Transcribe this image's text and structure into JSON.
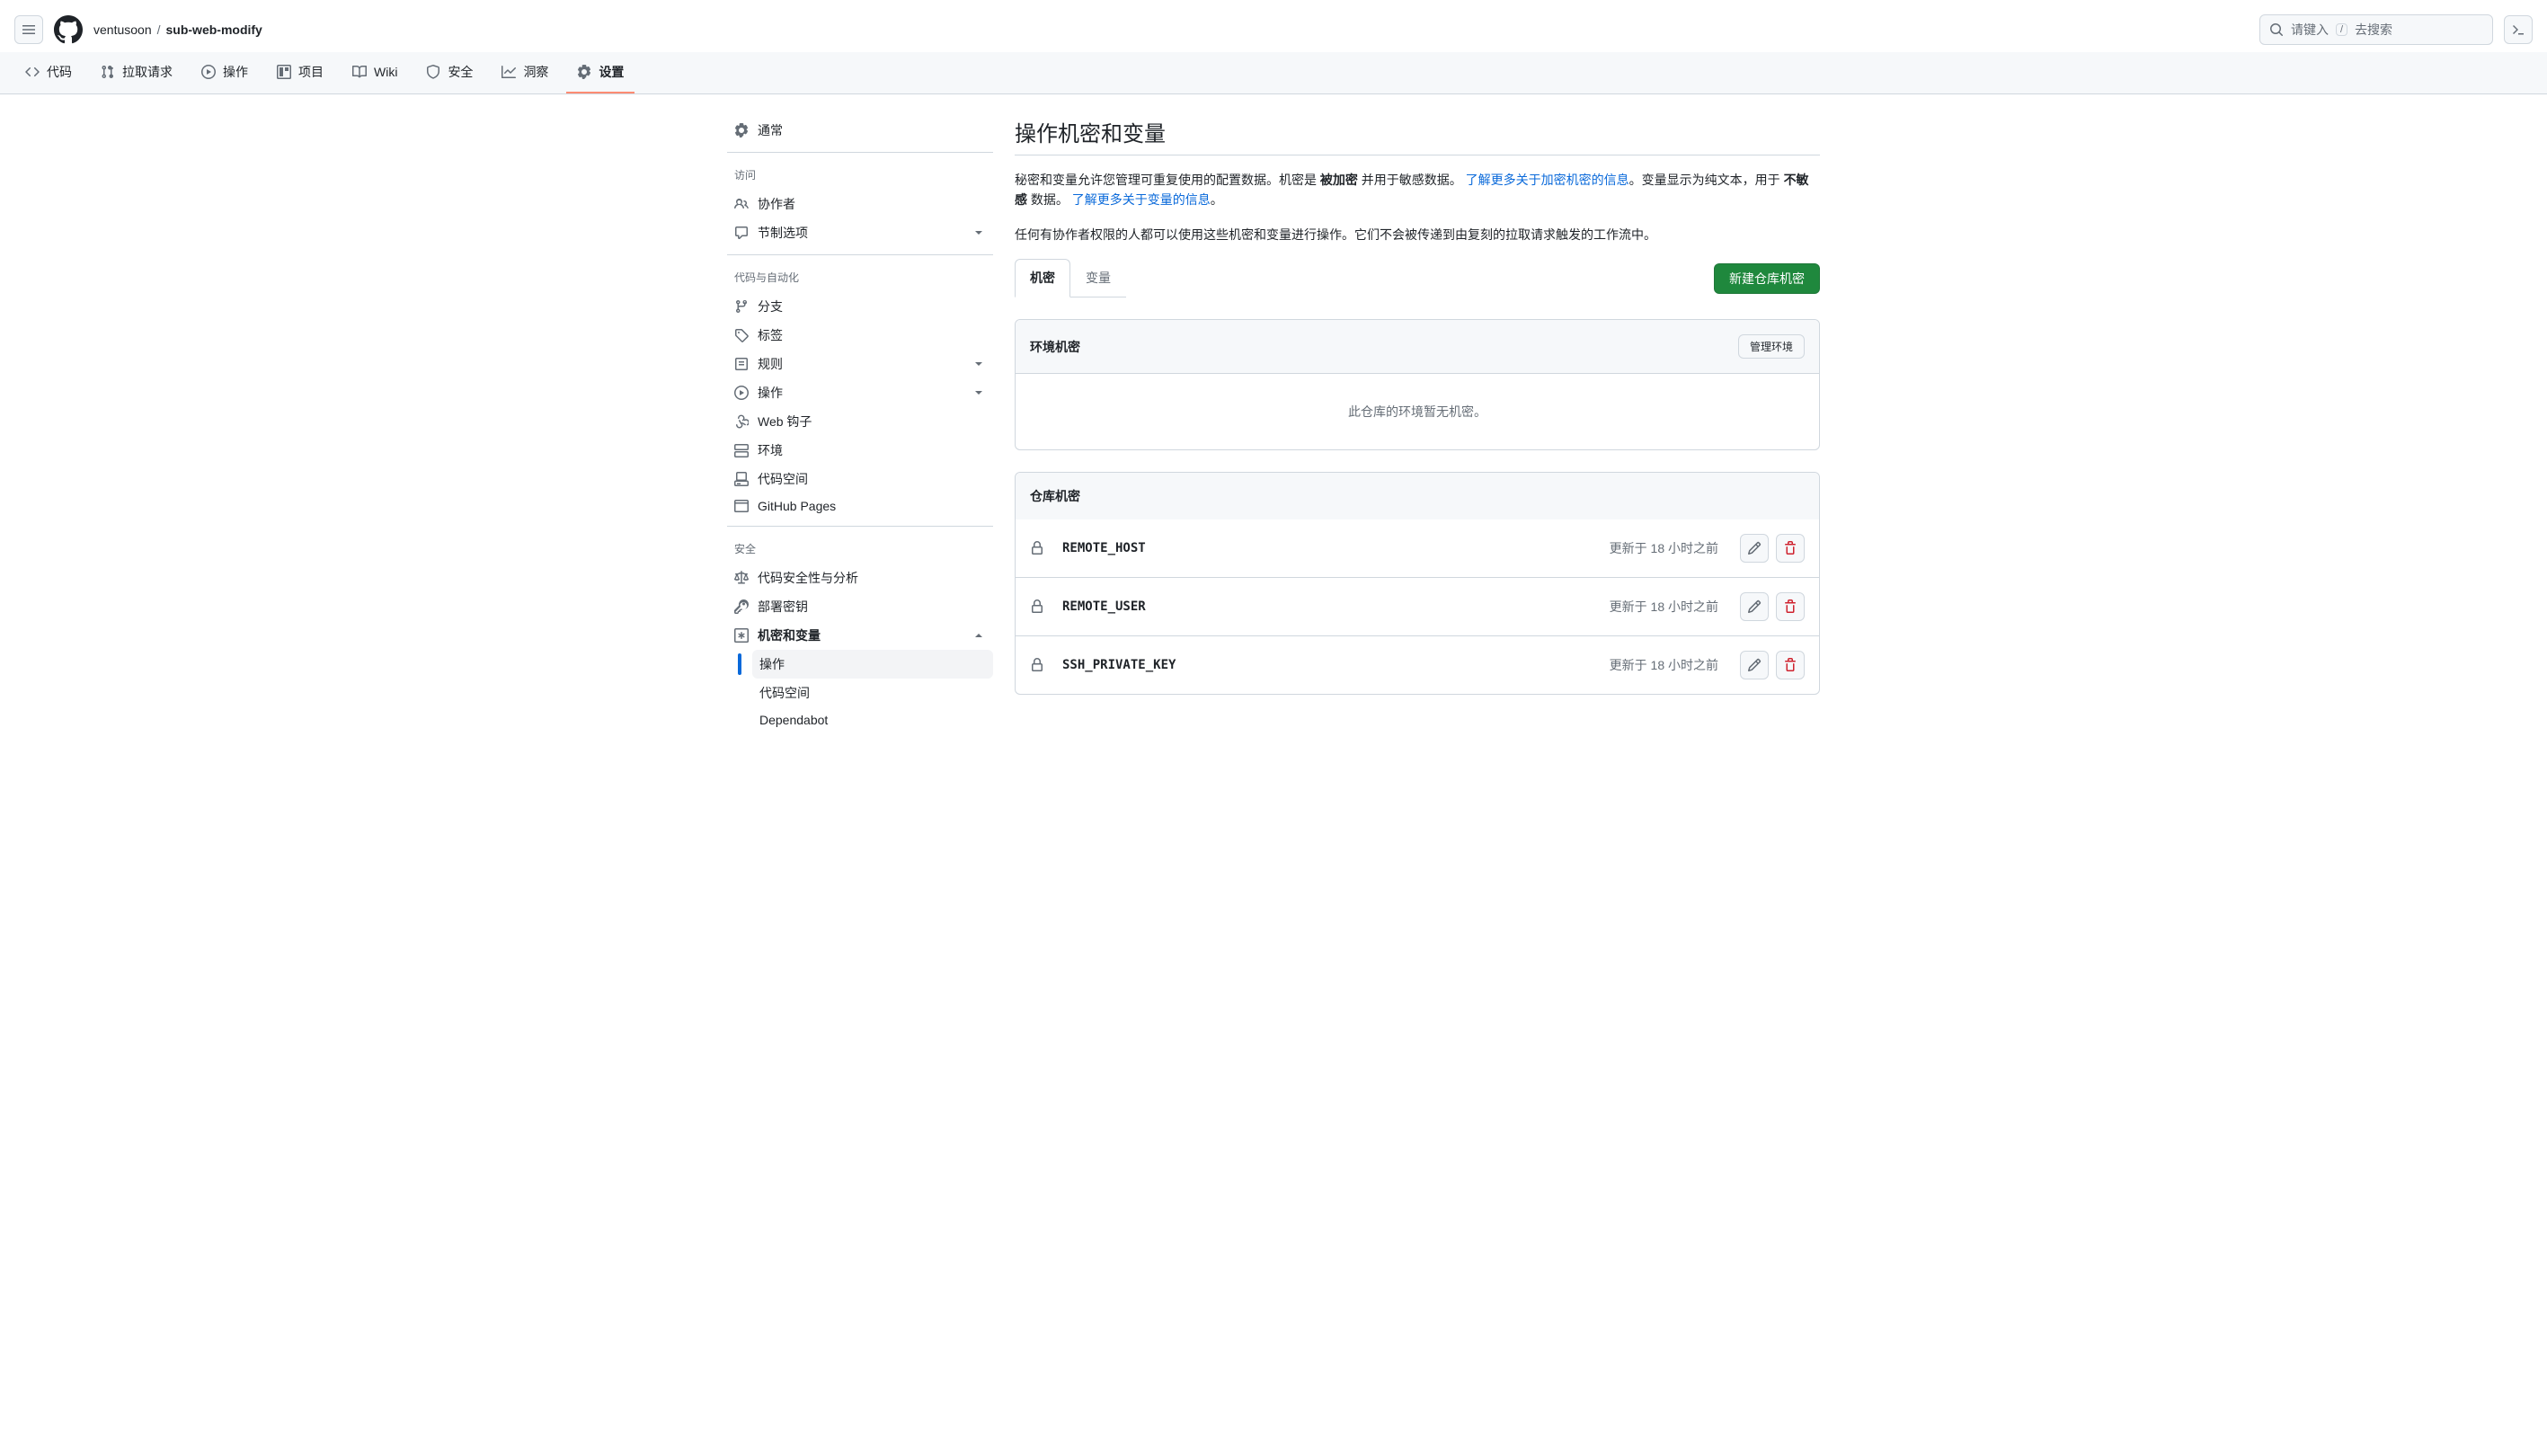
{
  "header": {
    "owner": "ventusoon",
    "sep": "/",
    "repo": "sub-web-modify",
    "search_placeholder": "请键入",
    "search_slash": "/",
    "search_suffix": "去搜索"
  },
  "repo_nav": {
    "code": "代码",
    "pulls": "拉取请求",
    "actions": "操作",
    "projects": "项目",
    "wiki": "Wiki",
    "security": "安全",
    "insights": "洞察",
    "settings": "设置"
  },
  "sidebar": {
    "general": "通常",
    "access_heading": "访问",
    "collaborators": "协作者",
    "moderation": "节制选项",
    "code_auto_heading": "代码与自动化",
    "branches": "分支",
    "tags": "标签",
    "rules": "规则",
    "actions": "操作",
    "webhooks": "Web 钩子",
    "environments": "环境",
    "codespaces": "代码空间",
    "pages": "GitHub Pages",
    "security_heading": "安全",
    "code_security": "代码安全性与分析",
    "deploy_keys": "部署密钥",
    "secrets_vars": "机密和变量",
    "sv_actions": "操作",
    "sv_codespaces": "代码空间",
    "sv_dependabot": "Dependabot"
  },
  "main": {
    "title": "操作机密和变量",
    "desc1_prefix": "秘密和变量允许您管理可重复使用的配置数据。机密是 ",
    "desc1_encrypted": "被加密",
    "desc1_mid": " 并用于敏感数据。 ",
    "desc1_link1": "了解更多关于加密机密的信息",
    "desc1_mid2": "。变量显示为纯文本，用于 ",
    "desc1_nonsensitive": "不敏感",
    "desc1_mid3": " 数据。 ",
    "desc1_link2": "了解更多关于变量的信息",
    "desc1_suffix": "。",
    "desc2": "任何有协作者权限的人都可以使用这些机密和变量进行操作。它们不会被传递到由复刻的拉取请求触发的工作流中。",
    "tab_secrets": "机密",
    "tab_variables": "变量",
    "btn_new_secret": "新建仓库机密",
    "env_secrets_title": "环境机密",
    "btn_manage_env": "管理环境",
    "env_empty": "此仓库的环境暂无机密。",
    "repo_secrets_title": "仓库机密",
    "secrets": [
      {
        "name": "REMOTE_HOST",
        "updated": "更新于 18 小时之前"
      },
      {
        "name": "REMOTE_USER",
        "updated": "更新于 18 小时之前"
      },
      {
        "name": "SSH_PRIVATE_KEY",
        "updated": "更新于 18 小时之前"
      }
    ]
  }
}
